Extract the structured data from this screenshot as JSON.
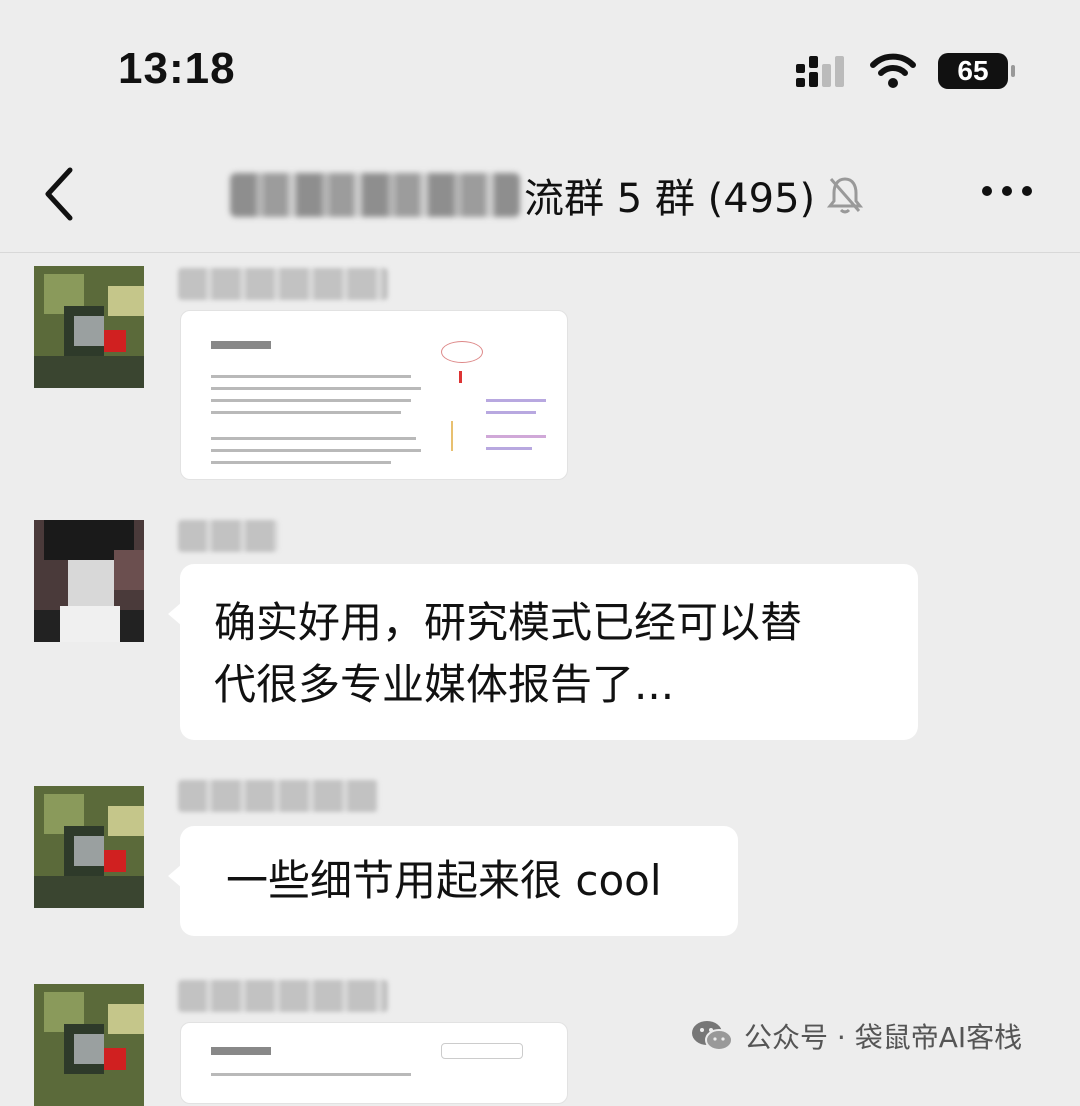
{
  "status": {
    "time": "13:18",
    "battery": "65"
  },
  "header": {
    "title": "流群 5 群 (495)"
  },
  "messages": [
    {
      "type": "image"
    },
    {
      "type": "text",
      "text_line1": "确实好用，研究模式已经可以替",
      "text_line2": "代很多专业媒体报告了..."
    },
    {
      "type": "text",
      "text": "一些细节用起来很 cool"
    },
    {
      "type": "image"
    }
  ],
  "watermark": {
    "text": "公众号 · 袋鼠帝AI客栈"
  },
  "colors": {
    "background": "#ededed",
    "bubble": "#ffffff"
  }
}
